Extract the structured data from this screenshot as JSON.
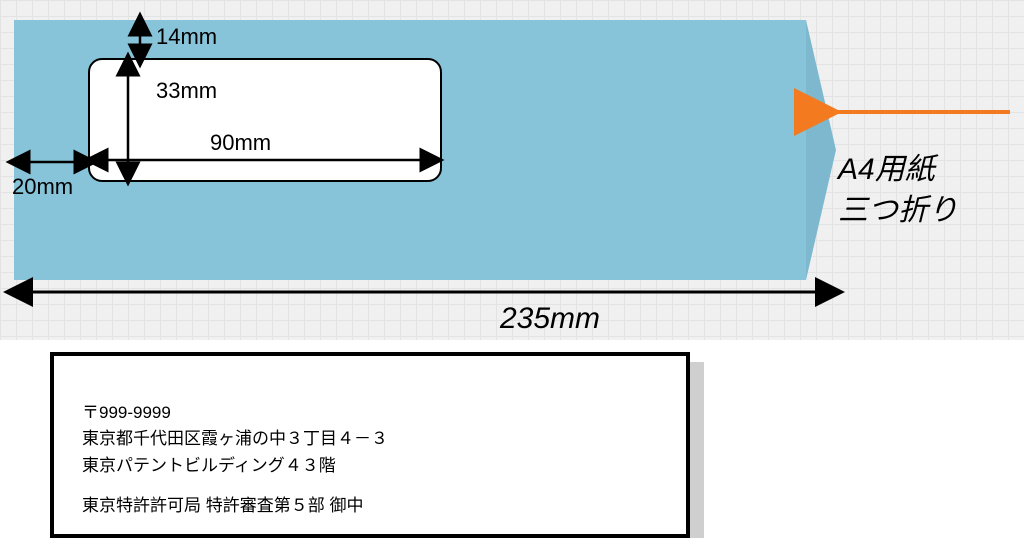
{
  "envelope_dims": {
    "top_margin": "14mm",
    "left_margin": "20mm",
    "window_height": "33mm",
    "window_width": "90mm",
    "total_width": "235mm"
  },
  "insert_label_line1": "A4用紙",
  "insert_label_line2": "三つ折り",
  "document": {
    "postal": "〒999-9999",
    "address1": "東京都千代田区霞ヶ浦の中３丁目４－３",
    "address2": "東京パテントビルディング４３階",
    "recipient": "東京特許許可局 特許審査第５部 御中"
  }
}
